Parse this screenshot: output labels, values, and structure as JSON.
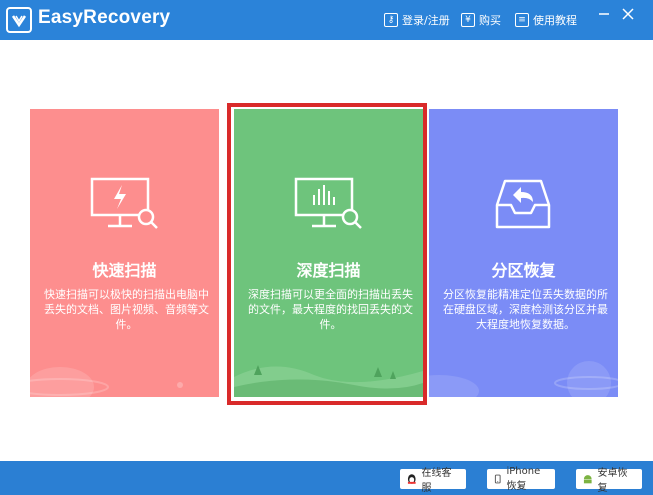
{
  "app": {
    "title": "EasyRecovery"
  },
  "titlebar": {
    "login_label": "登录/注册",
    "buy_label": "购买",
    "tutorial_label": "使用教程"
  },
  "cards": [
    {
      "title": "快速扫描",
      "description": "快速扫描可以极快的扫描出电脑中丢失的文档、图片视频、音频等文件。",
      "color": "#fd8e8e",
      "icon": "monitor-lightning-icon"
    },
    {
      "title": "深度扫描",
      "description": "深度扫描可以更全面的扫描出丢失的文件，最大程度的找回丢失的文件。",
      "color": "#6ec47c",
      "icon": "monitor-chart-icon",
      "selected": true
    },
    {
      "title": "分区恢复",
      "description": "分区恢复能精准定位丢失数据的所在硬盘区域，深度检测该分区并最大程度地恢复数据。",
      "color": "#7b8cf6",
      "icon": "inbox-restore-icon"
    }
  ],
  "footer": {
    "online_service_label": "在线客服",
    "iphone_recovery_label": "iPhone恢复",
    "android_recovery_label": "安卓恢复"
  },
  "colors": {
    "titlebar": "#2b83d9",
    "selected_border": "#d92a2a"
  }
}
